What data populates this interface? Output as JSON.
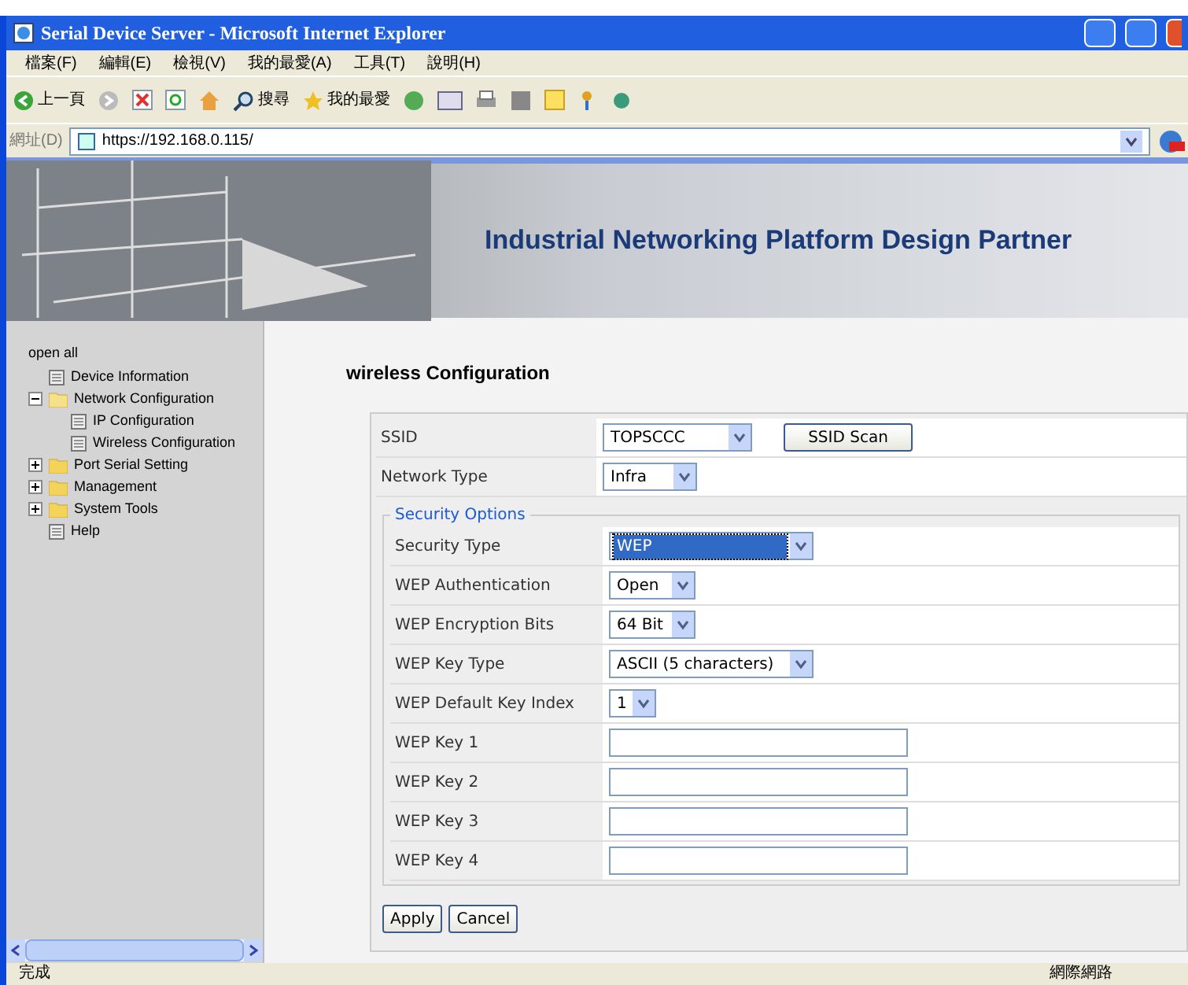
{
  "window": {
    "title": "Serial Device Server - Microsoft Internet Explorer"
  },
  "menu": [
    "檔案(F)",
    "編輯(E)",
    "檢視(V)",
    "我的最愛(A)",
    "工具(T)",
    "說明(H)"
  ],
  "toolbar": {
    "back": "上一頁",
    "search": "搜尋",
    "favorites": "我的最愛"
  },
  "address": {
    "label": "網址(D)",
    "url": "https://192.168.0.115/"
  },
  "banner": {
    "title": "Industrial Networking Platform Design Partner"
  },
  "sidebar": {
    "open_all": "open all",
    "items": [
      {
        "label": "Device Information",
        "kind": "page"
      },
      {
        "label": "Network Configuration",
        "kind": "folder",
        "expanded": true,
        "children": [
          {
            "label": "IP Configuration",
            "kind": "page"
          },
          {
            "label": "Wireless Configuration",
            "kind": "page"
          }
        ]
      },
      {
        "label": "Port Serial Setting",
        "kind": "folder",
        "expanded": false
      },
      {
        "label": "Management",
        "kind": "folder",
        "expanded": false
      },
      {
        "label": "System Tools",
        "kind": "folder",
        "expanded": false
      },
      {
        "label": "Help",
        "kind": "page"
      }
    ]
  },
  "form": {
    "heading": "wireless Configuration",
    "ssid": {
      "label": "SSID",
      "value": "TOPSCCC",
      "scan_button": "SSID Scan"
    },
    "network_type": {
      "label": "Network Type",
      "value": "Infra"
    },
    "security": {
      "legend": "Security Options",
      "rows": [
        {
          "label": "Security Type",
          "kind": "select",
          "value": "WEP",
          "focused": true
        },
        {
          "label": "WEP Authentication",
          "kind": "select",
          "value": "Open",
          "focused": false
        },
        {
          "label": "WEP Encryption Bits",
          "kind": "select",
          "value": "64 Bit",
          "focused": false
        },
        {
          "label": "WEP Key Type",
          "kind": "select",
          "value": "ASCII (5 characters)",
          "focused": false
        },
        {
          "label": "WEP Default Key Index",
          "kind": "select",
          "value": "1",
          "focused": false
        },
        {
          "label": "WEP Key 1",
          "kind": "input"
        },
        {
          "label": "WEP Key 2",
          "kind": "input"
        },
        {
          "label": "WEP Key 3",
          "kind": "input"
        },
        {
          "label": "WEP Key 4",
          "kind": "input"
        }
      ]
    },
    "buttons": [
      "Apply",
      "Cancel"
    ]
  },
  "status_bar": {
    "text": "完成",
    "zone": "網際網路"
  }
}
